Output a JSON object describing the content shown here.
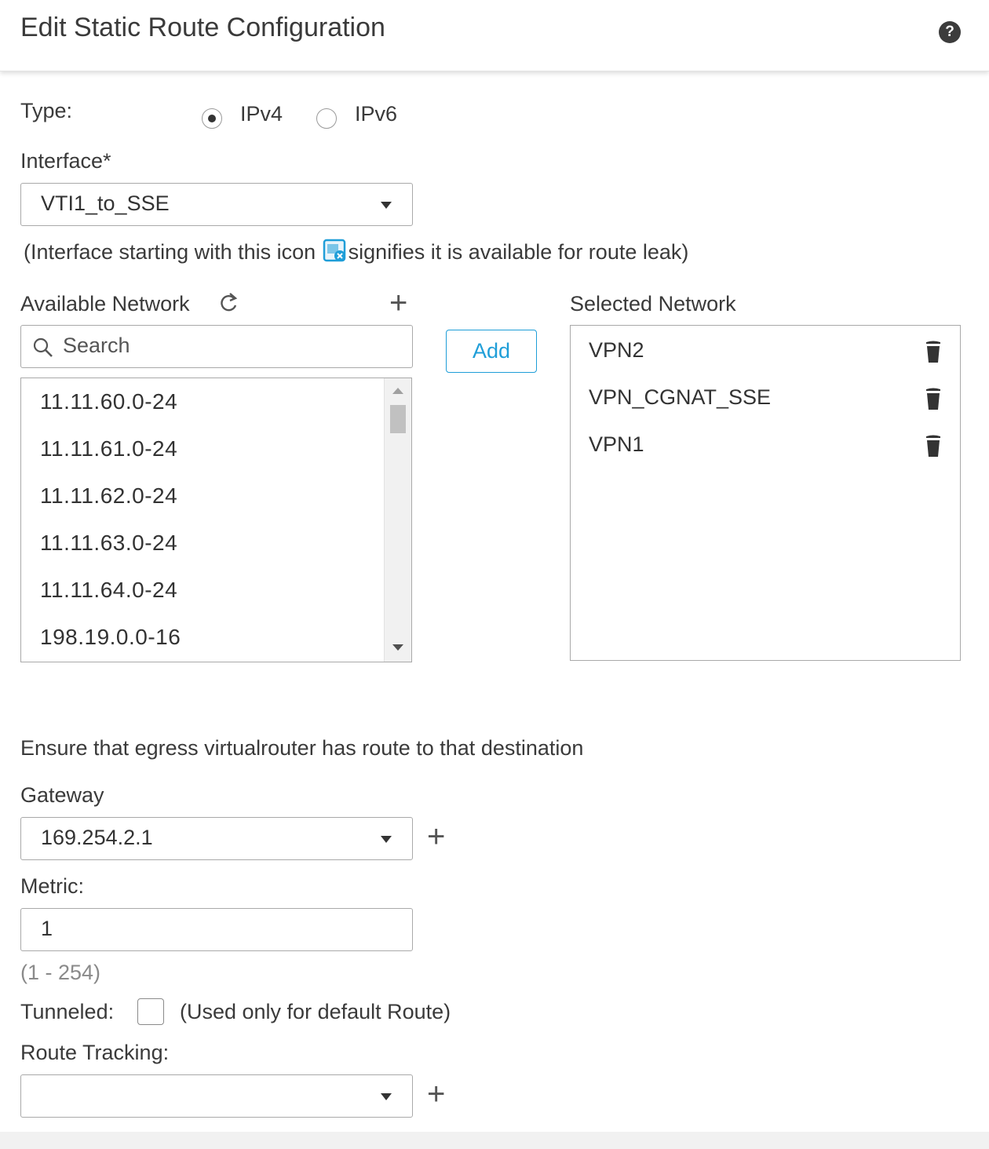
{
  "dialog": {
    "title": "Edit Static Route Configuration"
  },
  "type": {
    "label": "Type:",
    "options": [
      "IPv4",
      "IPv6"
    ],
    "selected": "IPv4"
  },
  "interface": {
    "label": "Interface*",
    "value": "VTI1_to_SSE",
    "hint_before": "(Interface starting with this icon ",
    "hint_after": "signifies it is available for route leak)"
  },
  "available": {
    "label": "Available Network",
    "search_placeholder": "Search",
    "items": [
      "11.11.60.0-24",
      "11.11.61.0-24",
      "11.11.62.0-24",
      "11.11.63.0-24",
      "11.11.64.0-24",
      "198.19.0.0-16"
    ]
  },
  "add_button": "Add",
  "selected": {
    "label": "Selected Network",
    "items": [
      "VPN2",
      "VPN_CGNAT_SSE",
      "VPN1"
    ]
  },
  "egress_note": "Ensure that egress virtualrouter has route to that destination",
  "gateway": {
    "label": "Gateway",
    "value": "169.254.2.1"
  },
  "metric": {
    "label": "Metric:",
    "value": "1",
    "range": "(1 - 254)"
  },
  "tunneled": {
    "label": "Tunneled:",
    "note": "(Used only for default Route)",
    "checked": false
  },
  "route_tracking": {
    "label": "Route Tracking:",
    "value": ""
  },
  "colors": {
    "accent": "#1f9ed8",
    "text": "#333333",
    "border": "#a9a9a9"
  }
}
